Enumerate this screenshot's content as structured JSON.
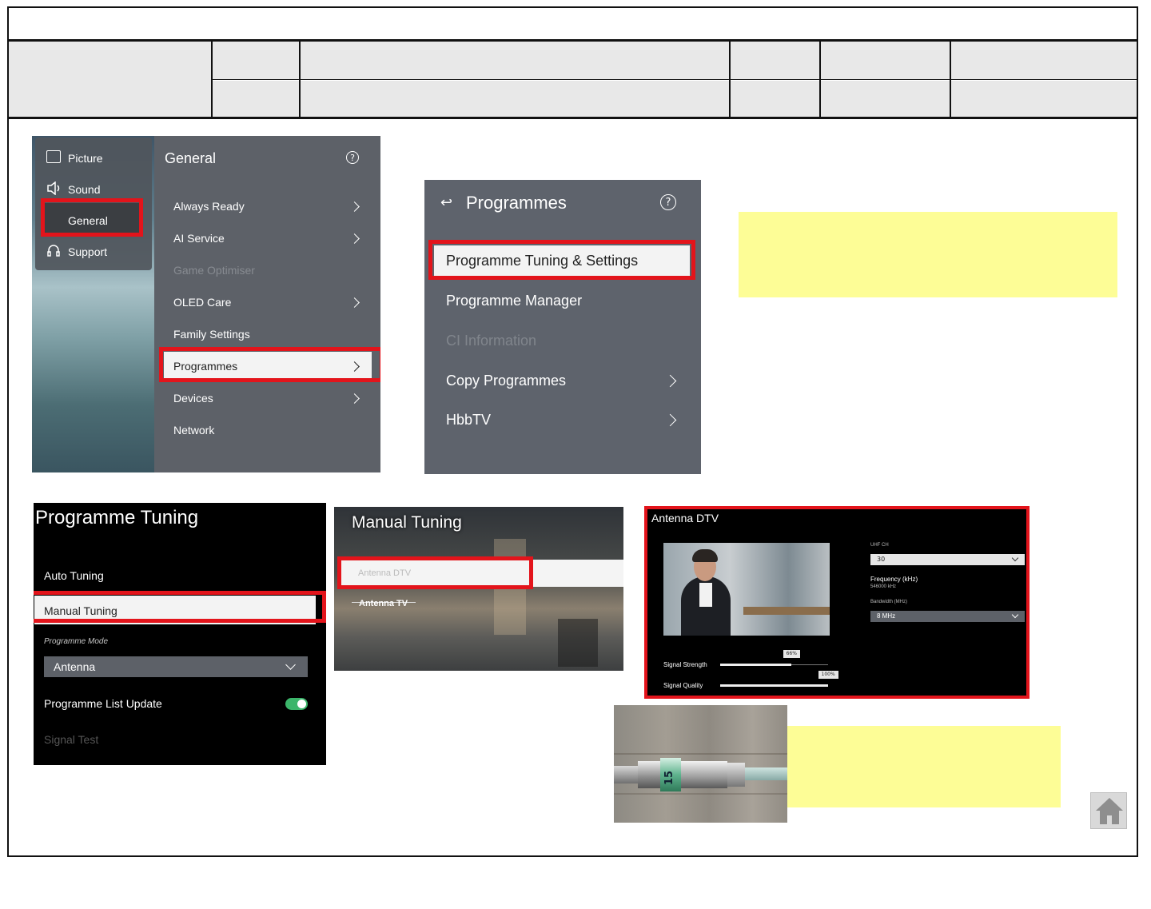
{
  "general_menu": {
    "sidebar": [
      "Picture",
      "Sound",
      "General",
      "Support"
    ],
    "title": "General",
    "items": [
      {
        "label": "Always Ready",
        "arrow": true,
        "enabled": true
      },
      {
        "label": "AI Service",
        "arrow": true,
        "enabled": true
      },
      {
        "label": "Game Optimiser",
        "arrow": false,
        "enabled": false
      },
      {
        "label": "OLED Care",
        "arrow": true,
        "enabled": true
      },
      {
        "label": "Family Settings",
        "arrow": false,
        "enabled": true
      },
      {
        "label": "Programmes",
        "arrow": true,
        "enabled": true
      },
      {
        "label": "Devices",
        "arrow": true,
        "enabled": true
      },
      {
        "label": "Network",
        "arrow": false,
        "enabled": true
      }
    ]
  },
  "programmes_menu": {
    "title": "Programmes",
    "items": [
      {
        "label": "Programme Tuning & Settings",
        "arrow": false,
        "enabled": true
      },
      {
        "label": "Programme Manager",
        "arrow": false,
        "enabled": true
      },
      {
        "label": "CI Information",
        "arrow": false,
        "enabled": false
      },
      {
        "label": "Copy Programmes",
        "arrow": true,
        "enabled": true
      },
      {
        "label": "HbbTV",
        "arrow": true,
        "enabled": true
      }
    ]
  },
  "programme_tuning": {
    "title": "Programme Tuning",
    "auto_tuning": "Auto Tuning",
    "manual_tuning": "Manual Tuning",
    "mode_label": "Programme Mode",
    "mode_value": "Antenna",
    "list_update": "Programme List Update",
    "list_update_on": true,
    "signal_test": "Signal Test"
  },
  "manual_tuning": {
    "title": "Manual Tuning",
    "option_1": "Antenna DTV",
    "option_2": "Antenna TV"
  },
  "antenna_dtv": {
    "title": "Antenna DTV",
    "uhf_label": "UHF CH",
    "uhf_value": "30",
    "freq_label": "Frequency (kHz)",
    "freq_value": "546000 kHz",
    "bw_label": "Bandwidth (MHz)",
    "bw_value": "8 MHz",
    "strength_label": "Signal Strength",
    "strength_value": "66%",
    "strength_level": 0.66,
    "quality_label": "Signal Quality",
    "quality_value": "100%",
    "quality_level": 1.0
  },
  "connector_label": "15"
}
